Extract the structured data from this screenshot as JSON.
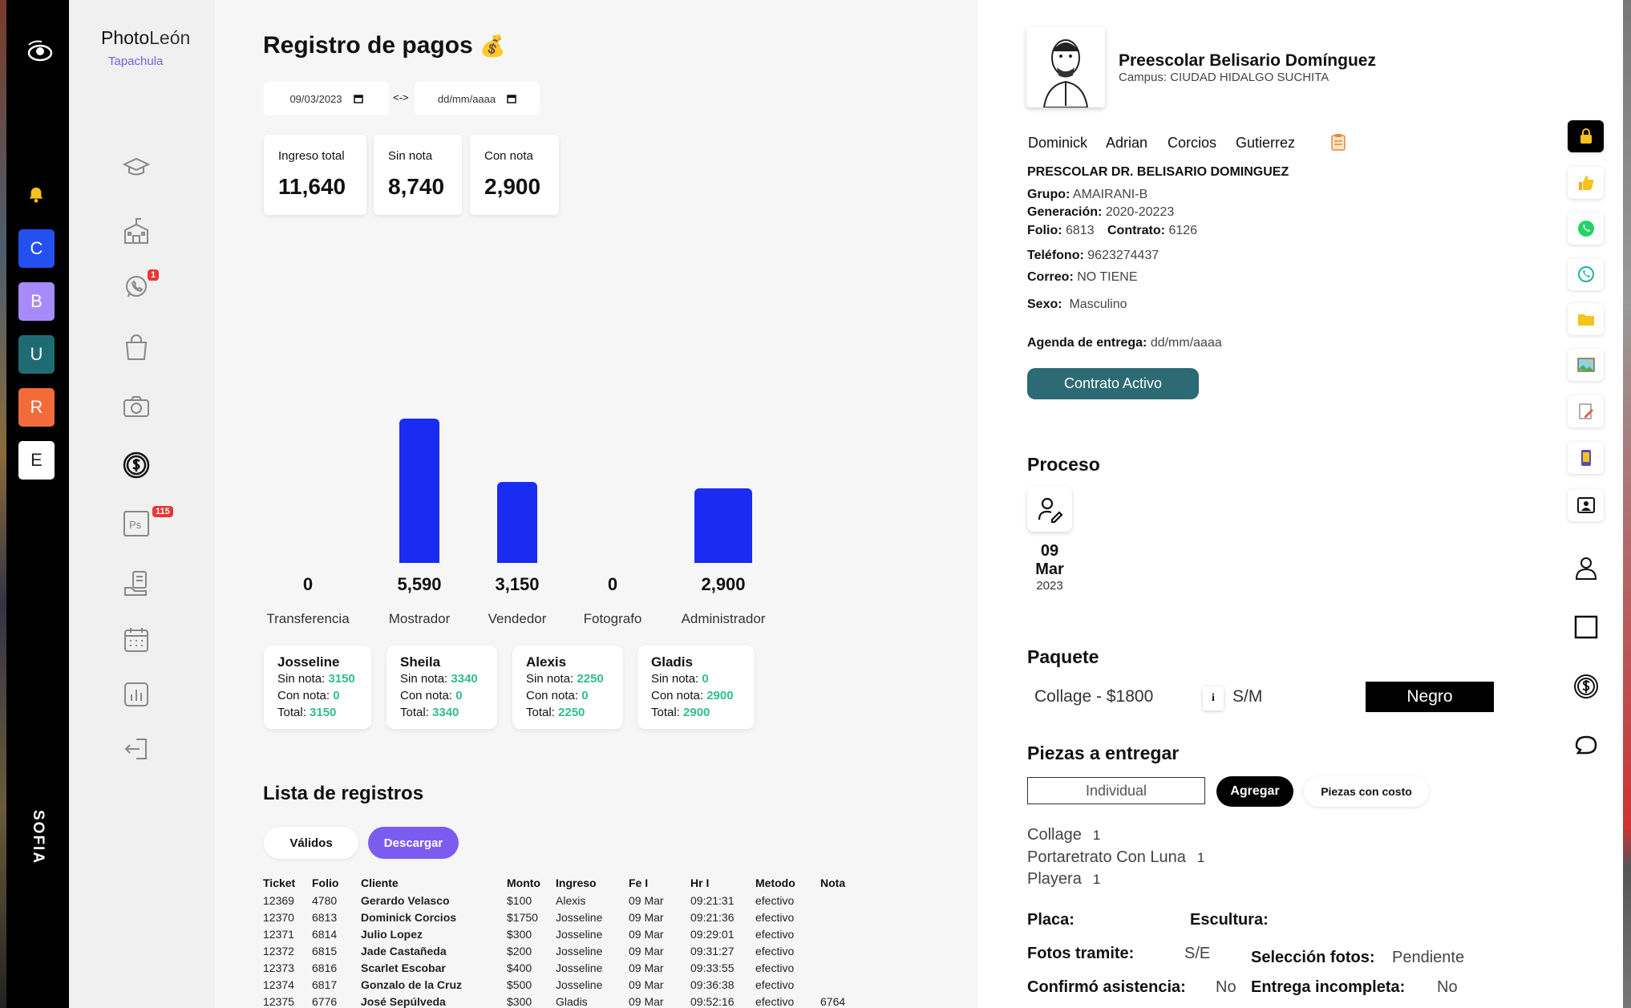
{
  "sidebar_rail": {
    "apps": [
      {
        "letter": "C",
        "color": "#2450f0"
      },
      {
        "letter": "B",
        "color": "#a78bfa"
      },
      {
        "letter": "U",
        "color": "#1f6b73"
      },
      {
        "letter": "R",
        "color": "#f26b3a"
      },
      {
        "letter": "E",
        "color": "#ffffff"
      }
    ],
    "vertical_label": "SOFIA"
  },
  "brand": {
    "name_a": "Photo",
    "name_b": "León",
    "subtitle": "Tapachula"
  },
  "menu": {
    "whatsapp_badge": "1",
    "ps_badge": "115",
    "ps_label": "Ps"
  },
  "header": {
    "title": "Registro de pagos",
    "title_emoji": "💰",
    "date_from": "09/03/2023",
    "date_to": "dd/mm/aaaa",
    "date_separator": "<->"
  },
  "kpis": [
    {
      "label": "Ingreso total",
      "value": "11,640"
    },
    {
      "label": "Sin nota",
      "value": "8,740"
    },
    {
      "label": "Con nota",
      "value": "2,900"
    }
  ],
  "chart_data": {
    "type": "bar",
    "categories": [
      "Transferencia",
      "Mostrador",
      "Vendedor",
      "Fotografo",
      "Administrador"
    ],
    "values": [
      0,
      5590,
      3150,
      0,
      2900
    ],
    "value_labels": [
      "0",
      "5,590",
      "3,150",
      "0",
      "2,900"
    ],
    "bar_color": "#1a2cf2"
  },
  "employees": [
    {
      "name": "Josseline",
      "sin_label": "Sin nota:",
      "sin": "3150",
      "con_label": "Con nota:",
      "con": "0",
      "tot_label": "Total:",
      "total": "3150"
    },
    {
      "name": "Sheila",
      "sin_label": "Sin nota:",
      "sin": "3340",
      "con_label": "Con nota:",
      "con": "0",
      "tot_label": "Total:",
      "total": "3340"
    },
    {
      "name": "Alexis",
      "sin_label": "Sin nota:",
      "sin": "2250",
      "con_label": "Con nota:",
      "con": "0",
      "tot_label": "Total:",
      "total": "2250"
    },
    {
      "name": "Gladis",
      "sin_label": "Sin nota:",
      "sin": "0",
      "con_label": "Con nota:",
      "con": "2900",
      "tot_label": "Total:",
      "total": "2900"
    }
  ],
  "registros": {
    "title": "Lista de registros",
    "btn_validos": "Válidos",
    "btn_descargar": "Descargar",
    "columns": [
      "Ticket",
      "Folio",
      "Cliente",
      "Monto",
      "Ingreso",
      "Fe I",
      "Hr I",
      "Metodo",
      "Nota"
    ],
    "rows": [
      [
        "12369",
        "4780",
        "Gerardo Velasco",
        "$100",
        "Alexis",
        "09 Mar",
        "09:21:31",
        "efectivo",
        ""
      ],
      [
        "12370",
        "6813",
        "Dominick Corcios",
        "$1750",
        "Josseline",
        "09 Mar",
        "09:21:36",
        "efectivo",
        ""
      ],
      [
        "12371",
        "6814",
        "Julio Lopez",
        "$300",
        "Josseline",
        "09 Mar",
        "09:29:01",
        "efectivo",
        ""
      ],
      [
        "12372",
        "6815",
        "Jade Castañeda",
        "$200",
        "Josseline",
        "09 Mar",
        "09:31:27",
        "efectivo",
        ""
      ],
      [
        "12373",
        "6816",
        "Scarlet Escobar",
        "$400",
        "Josseline",
        "09 Mar",
        "09:33:55",
        "efectivo",
        ""
      ],
      [
        "12374",
        "6817",
        "Gonzalo de la Cruz",
        "$500",
        "Josseline",
        "09 Mar",
        "09:36:38",
        "efectivo",
        ""
      ],
      [
        "12375",
        "6776",
        "José Sepúlveda",
        "$300",
        "Gladis",
        "09 Mar",
        "09:52:16",
        "efectivo",
        "6764"
      ]
    ]
  },
  "detail": {
    "school": "Preescolar Belisario Domínguez",
    "campus": "Campus: CIUDAD HIDALGO SUCHITA",
    "names": [
      "Dominick",
      "Adrian",
      "Corcios",
      "Gutierrez"
    ],
    "school_upper": "PRESCOLAR DR. BELISARIO DOMINGUEZ",
    "grupo_l": "Grupo:",
    "grupo_v": "AMAIRANI-B",
    "gen_l": "Generación:",
    "gen_v": "2020-20223",
    "folio_l": "Folio:",
    "folio_v": "6813",
    "contrato_l": "Contrato:",
    "contrato_v": "6126",
    "tel_l": "Teléfono:",
    "tel_v": "9623274437",
    "correo_l": "Correo:",
    "correo_v": "NO TIENE",
    "sexo_l": "Sexo:",
    "sexo_v": "Masculino",
    "agenda_l": "Agenda de entrega:",
    "agenda_v": "dd/mm/aaaa",
    "btn_contrato": "Contrato Activo",
    "proceso_title": "Proceso",
    "proceso_day": "09",
    "proceso_month": "Mar",
    "proceso_year": "2023",
    "paquete_title": "Paquete",
    "paquete_name": "Collage - $1800",
    "paquete_info": "i",
    "paquete_size": "S/M",
    "paquete_color": "Negro",
    "piezas_title": "Piezas a entregar",
    "piezas_select": "Individual",
    "btn_agregar": "Agregar",
    "btn_piezas_costo": "Piezas con costo",
    "piezas": [
      {
        "name": "Collage",
        "qty": "1"
      },
      {
        "name": "Portaretrato Con Luna",
        "qty": "1"
      },
      {
        "name": "Playera",
        "qty": "1"
      }
    ],
    "placa_l": "Placa:",
    "escultura_l": "Escultura:",
    "fotos_tramite_l": "Fotos tramite:",
    "fotos_tramite_v": "S/E",
    "seleccion_l": "Selección fotos:",
    "seleccion_v": "Pendiente",
    "confirmo_l": "Confirmó asistencia:",
    "confirmo_v": "No",
    "entrega_l": "Entrega incompleta:",
    "entrega_v": "No"
  }
}
